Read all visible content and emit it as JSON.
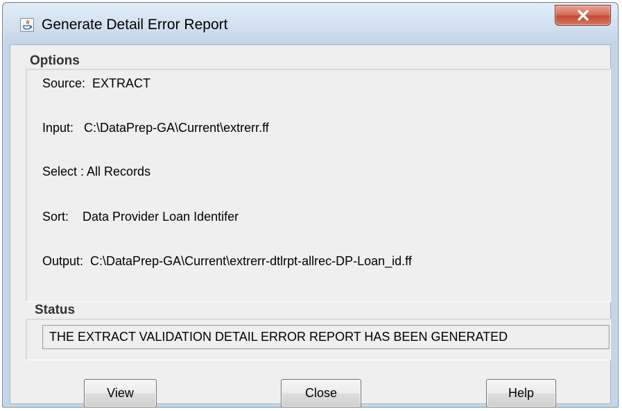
{
  "window": {
    "title": "Generate Detail Error Report",
    "app_icon": "java-icon",
    "close_icon": "close-icon",
    "close_color": "#c94b36"
  },
  "options": {
    "heading": "Options",
    "source_line": "Source:  EXTRACT",
    "input_line": "Input:   C:\\DataPrep-GA\\Current\\extrerr.ff",
    "select_line": "Select : All Records",
    "sort_line": "Sort:    Data Provider Loan Identifer",
    "output_line": "Output:  C:\\DataPrep-GA\\Current\\extrerr-dtlrpt-allrec-DP-Loan_id.ff"
  },
  "status": {
    "heading": "Status",
    "message": "THE EXTRACT VALIDATION DETAIL ERROR REPORT HAS BEEN GENERATED"
  },
  "buttons": {
    "view": "View",
    "close": "Close",
    "help": "Help"
  }
}
